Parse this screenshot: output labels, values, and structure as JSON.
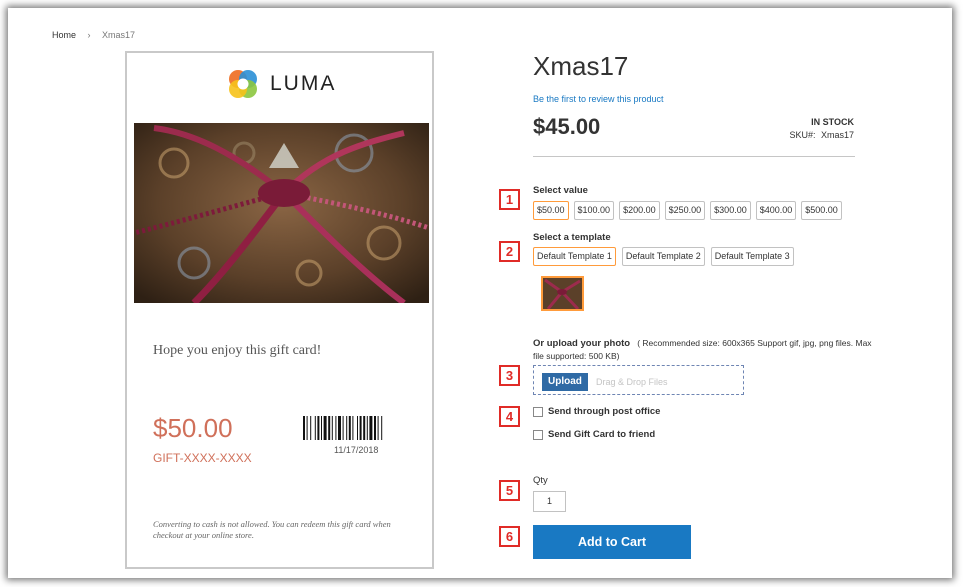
{
  "breadcrumb": {
    "home": "Home",
    "separator": "›",
    "current": "Xmas17"
  },
  "card_preview": {
    "logo_text": "LUMA",
    "message": "Hope you enjoy this gift card!",
    "amount": "$50.00",
    "code": "GIFT-XXXX-XXXX",
    "date": "11/17/2018",
    "disclaimer": "Converting to cash is not allowed. You can redeem this gift card when checkout at your online store."
  },
  "product": {
    "title": "Xmas17",
    "review_link": "Be the first to review this product",
    "price": "$45.00",
    "stock": "IN STOCK",
    "sku_label": "SKU#:",
    "sku_value": "Xmas17"
  },
  "markers": [
    "1",
    "2",
    "3",
    "4",
    "5",
    "6"
  ],
  "value_selector": {
    "label": "Select value",
    "options": [
      "$50.00",
      "$100.00",
      "$200.00",
      "$250.00",
      "$300.00",
      "$400.00",
      "$500.00"
    ],
    "selected": "$50.00"
  },
  "template_selector": {
    "label": "Select a template",
    "options": [
      "Default Template 1",
      "Default Template 2",
      "Default Template 3"
    ],
    "selected": "Default Template 1"
  },
  "upload": {
    "title": "Or upload your photo",
    "hint": "( Recommended size: 600x365 Support gif, jpg, png files. Max file supported: 500 KB)",
    "button": "Upload",
    "drop_text": "Drag & Drop Files"
  },
  "options": {
    "post_office": "Send through post office",
    "friend": "Send Gift Card to friend"
  },
  "qty": {
    "label": "Qty",
    "value": "1"
  },
  "cart": {
    "button": "Add to Cart"
  },
  "colors": {
    "accent": "#1979c3",
    "selected_border": "#ff9b3b",
    "marker": "#e02b27",
    "card_amount": "#d0705a"
  }
}
